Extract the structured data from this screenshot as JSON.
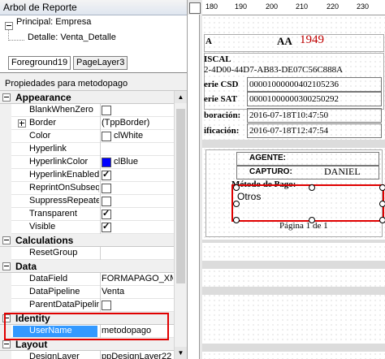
{
  "panel": {
    "title": "Arbol de Reporte",
    "tree": {
      "root": "Principal: Empresa",
      "child": "Detalle: Venta_Detalle"
    },
    "tabs": [
      "Foreground19",
      "PageLayer3"
    ],
    "props_header": "Propiedades para metodopago"
  },
  "categories": {
    "appearance": "Appearance",
    "calculations": "Calculations",
    "data": "Data",
    "identity": "Identity",
    "layout": "Layout"
  },
  "appearance_rows": [
    {
      "name": "BlankWhenZero",
      "value": ""
    },
    {
      "name": "Border",
      "value": "(TppBorder)"
    },
    {
      "name": "Color",
      "value": "clWhite"
    },
    {
      "name": "Hyperlink",
      "value": ""
    },
    {
      "name": "HyperlinkColor",
      "value": "clBlue"
    },
    {
      "name": "HyperlinkEnabled",
      "value": ""
    },
    {
      "name": "ReprintOnSubseque",
      "value": ""
    },
    {
      "name": "SuppressRepeated",
      "value": ""
    },
    {
      "name": "Transparent",
      "value": ""
    },
    {
      "name": "Visible",
      "value": ""
    }
  ],
  "calc_rows": [
    {
      "name": "ResetGroup",
      "value": ""
    }
  ],
  "data_rows": [
    {
      "name": "DataField",
      "value": "FORMAPAGO_XM"
    },
    {
      "name": "DataPipeline",
      "value": "Venta"
    },
    {
      "name": "ParentDataPipelin",
      "value": ""
    }
  ],
  "identity_rows": [
    {
      "name": "UserName",
      "value": "metodopago"
    }
  ],
  "layout_rows": [
    {
      "name": "DesignLayer",
      "value": "ppDesignLayer22"
    }
  ],
  "colors": {
    "clWhite": "#ffffff",
    "clBlue": "#0000ff",
    "highlight": "#e00000",
    "selection": "#3399ff"
  },
  "designer": {
    "ruler_marks": [
      "180",
      "190",
      "200",
      "210",
      "220",
      "230"
    ],
    "doc_prefix": "AA",
    "doc_number": "1949",
    "labels": {
      "a": "A",
      "fiscal": "ISCAL",
      "uuid": "2-4D00-44D7-AB83-DE07C56C888A",
      "serie_csd": "erie CSD",
      "csd_value": "00001000000402105236",
      "serie_sat": "erie SAT",
      "sat_value": "00001000000300250292",
      "elaboracion": "boración:",
      "elab_value": "2016-07-18T10:47:50",
      "certificacion": "ificación:",
      "cert_value": "2016-07-18T12:47:54",
      "agente": "AGENTE:",
      "capturo": "CAPTURO:",
      "capturo_value": "DANIEL",
      "metodo_pago": "Método de Pago:",
      "otros": "Otros",
      "pagina": "Página 1 de 1"
    }
  }
}
